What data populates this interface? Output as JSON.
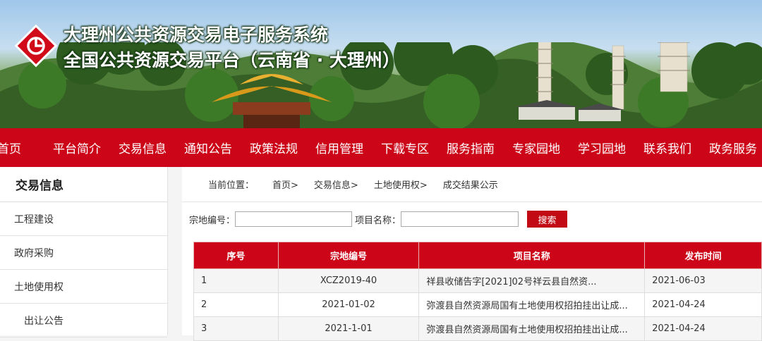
{
  "header": {
    "title_line1": "大理州公共资源交易电子服务系统",
    "title_line2": "全国公共资源交易平台（云南省 · 大理州）",
    "logo_icon": "platform-logo-icon",
    "colors": {
      "brand_red": "#cc0618"
    }
  },
  "nav": {
    "items": [
      {
        "label": "首页"
      },
      {
        "label": "平台简介"
      },
      {
        "label": "交易信息"
      },
      {
        "label": "通知公告"
      },
      {
        "label": "政策法规"
      },
      {
        "label": "信用管理"
      },
      {
        "label": "下载专区"
      },
      {
        "label": "服务指南"
      },
      {
        "label": "专家园地"
      },
      {
        "label": "学习园地"
      },
      {
        "label": "联系我们"
      },
      {
        "label": "政务服务"
      }
    ]
  },
  "sidebar": {
    "title": "交易信息",
    "items": [
      {
        "label": "工程建设"
      },
      {
        "label": "政府采购"
      },
      {
        "label": "土地使用权"
      },
      {
        "label": "出让公告"
      }
    ]
  },
  "breadcrumb": {
    "prefix": "当前位置：",
    "items": [
      "首页>",
      "交易信息>",
      "土地使用权>",
      "成交结果公示"
    ]
  },
  "search": {
    "code_label": "宗地编号：",
    "code_value": "",
    "name_label": "项目名称：",
    "name_value": "",
    "button_label": "搜索"
  },
  "table": {
    "columns": [
      "序号",
      "宗地编号",
      "项目名称",
      "发布时间"
    ],
    "rows": [
      [
        "1",
        "XCZ2019-40",
        "祥县收储告字[2021]02号祥云县自然资...",
        "2021-06-03"
      ],
      [
        "2",
        "2021-01-02",
        "弥渡县自然资源局国有土地使用权招拍挂出让成...",
        "2021-04-24"
      ],
      [
        "3",
        "2021-1-01",
        "弥渡县自然资源局国有土地使用权招拍挂出让成...",
        "2021-04-24"
      ]
    ]
  }
}
